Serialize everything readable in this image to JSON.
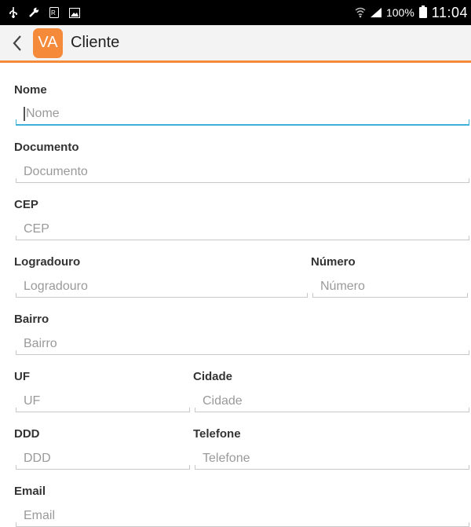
{
  "status_bar": {
    "icons": [
      "usb-icon",
      "wrench-icon",
      "rx-icon",
      "image-icon",
      "wifi-icon",
      "signal-icon",
      "battery-icon"
    ],
    "battery": "100%",
    "time": "11:04"
  },
  "header": {
    "logo": "VA",
    "title": "Cliente"
  },
  "form": {
    "nome": {
      "label": "Nome",
      "placeholder": "Nome"
    },
    "documento": {
      "label": "Documento",
      "placeholder": "Documento"
    },
    "cep": {
      "label": "CEP",
      "placeholder": "CEP"
    },
    "logradouro": {
      "label": "Logradouro",
      "placeholder": "Logradouro"
    },
    "numero": {
      "label": "Número",
      "placeholder": "Número"
    },
    "bairro": {
      "label": "Bairro",
      "placeholder": "Bairro"
    },
    "uf": {
      "label": "UF",
      "placeholder": "UF"
    },
    "cidade": {
      "label": "Cidade",
      "placeholder": "Cidade"
    },
    "ddd": {
      "label": "DDD",
      "placeholder": "DDD"
    },
    "telefone": {
      "label": "Telefone",
      "placeholder": "Telefone"
    },
    "email": {
      "label": "Email",
      "placeholder": "Email"
    }
  },
  "colors": {
    "accent": "#f58a3a",
    "focus": "#3fb1d8",
    "status_bar": "#000000",
    "action_bar": "#f3f3f3"
  }
}
